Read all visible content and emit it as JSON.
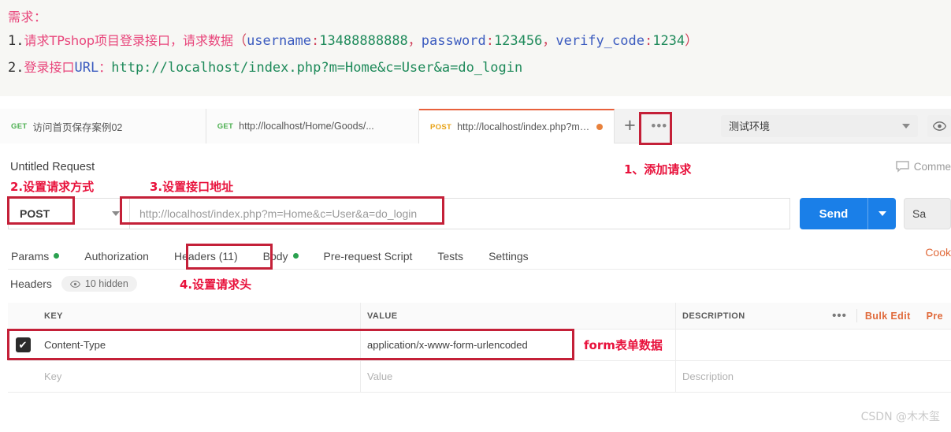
{
  "requirement": {
    "title": "需求：",
    "line1": {
      "num": "1.",
      "cn1": "请求TPshop项目登录接口，请求数据",
      "paren_open": "（",
      "k1": "username",
      "sep": ":",
      "v1": "13488888888",
      "comma": "，",
      "k2": "password",
      "v2": "123456",
      "k3": "verify_code",
      "v3": "1234",
      "paren_close": "）"
    },
    "line2": {
      "num": "2.",
      "cn": "登录接口",
      "url_label": "URL",
      "colon": "：",
      "url": "http://localhost/index.php?m=Home&c=User&a=do_login"
    }
  },
  "tabs": [
    {
      "method": "GET",
      "label": "访问首页保存案例02",
      "active": false,
      "unsaved": false
    },
    {
      "method": "GET",
      "label": "http://localhost/Home/Goods/...",
      "active": false,
      "unsaved": false
    },
    {
      "method": "POST",
      "label": "http://localhost/index.php?m=...",
      "active": true,
      "unsaved": true
    }
  ],
  "tabbar": {
    "add_tab": "+",
    "more": "•••",
    "environment": "测试环境",
    "eye_icon": "eye-icon"
  },
  "request": {
    "title": "Untitled Request",
    "comments_label": "Comme",
    "method": "POST",
    "url_value": "http://localhost/index.php?m=Home&c=User&a=do_login",
    "send_label": "Send",
    "save_label": "Sa"
  },
  "subtabs": [
    {
      "label": "Params",
      "dot": true
    },
    {
      "label": "Authorization",
      "dot": false
    },
    {
      "label": "Headers (11)",
      "dot": false
    },
    {
      "label": "Body",
      "dot": true
    },
    {
      "label": "Pre-request Script",
      "dot": false
    },
    {
      "label": "Tests",
      "dot": false
    },
    {
      "label": "Settings",
      "dot": false
    }
  ],
  "cookies_link": "Cook",
  "headers_panel": {
    "label": "Headers",
    "hidden_pill": "10 hidden",
    "columns": {
      "key": "KEY",
      "value": "VALUE",
      "description": "DESCRIPTION"
    },
    "actions": {
      "dots": "•••",
      "bulk_edit": "Bulk Edit",
      "presets": "Pre"
    },
    "rows": [
      {
        "checked": true,
        "key": "Content-Type",
        "value": "application/x-www-form-urlencoded",
        "description": ""
      }
    ],
    "empty_row": {
      "key": "Key",
      "value": "Value",
      "description": "Description"
    }
  },
  "annotations": {
    "a1": "1、添加请求",
    "a2": "2.设置请求方式",
    "a3": "3.设置接口地址",
    "a4": "4.设置请求头",
    "a5": "form表单数据"
  },
  "watermark": "CSDN @木木玺",
  "colors": {
    "accent_blue": "#1a7fe8",
    "annotation_red": "#e8123c",
    "box_red": "#c42038",
    "active_tab_orange": "#e8613c",
    "get_green": "#4caf50",
    "post_orange": "#e8a317",
    "link_orange": "#e06a3b"
  }
}
